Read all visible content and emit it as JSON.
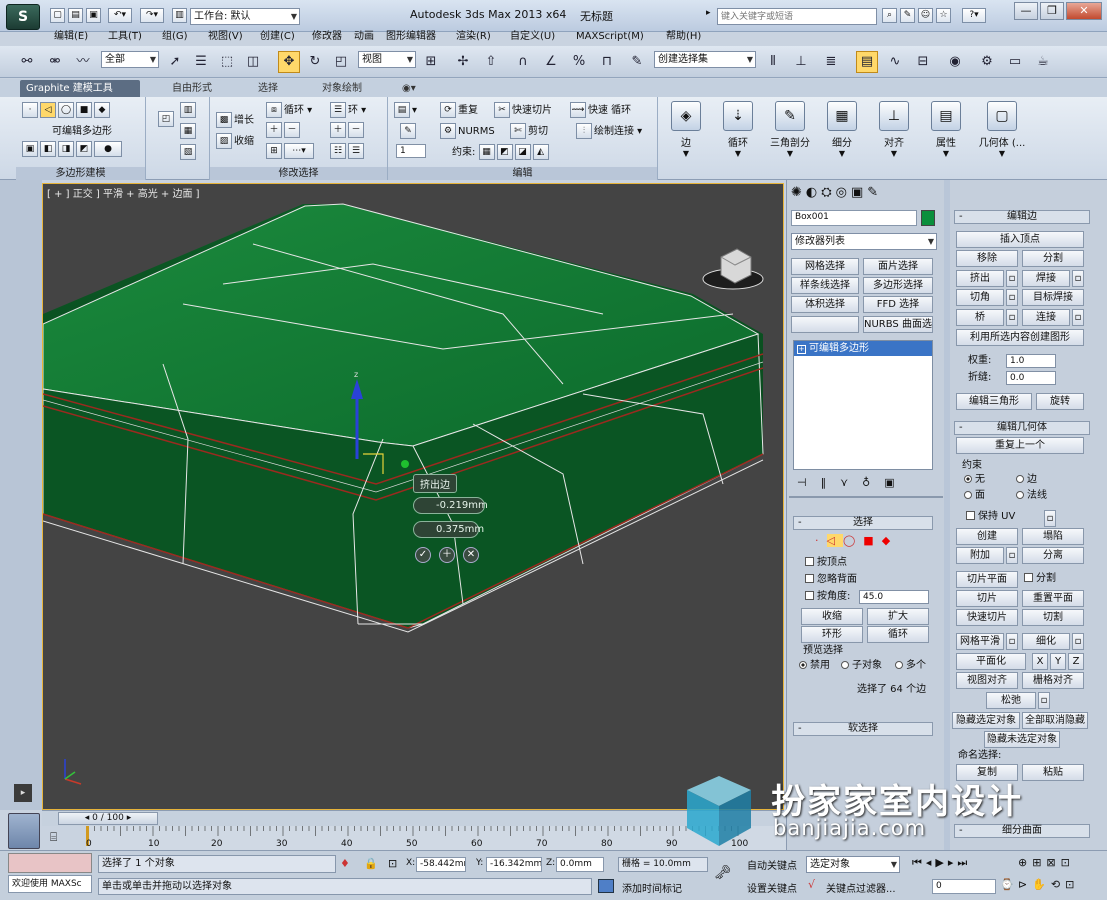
{
  "app": {
    "title": "Autodesk 3ds Max  2013 x64",
    "doc": "无标题",
    "workspace": "工作台: 默认",
    "search_placeholder": "键入关键字或短语",
    "logo": "S",
    "quick_icons": [
      "new-icon",
      "open-icon",
      "save-icon",
      "undo-icon",
      "redo-icon",
      "project-icon"
    ],
    "window_controls": [
      "—",
      "❐",
      "✕"
    ]
  },
  "menus": [
    "编辑(E)",
    "工具(T)",
    "组(G)",
    "视图(V)",
    "创建(C)",
    "修改器",
    "动画",
    "图形编辑器",
    "渲染(R)",
    "自定义(U)",
    "MAXScript(M)",
    "帮助(H)"
  ],
  "main_toolbar": {
    "selection_filter": "全部",
    "ref_coord": "视图",
    "named_selection": "创建选择集"
  },
  "ribbon": {
    "tabs": [
      "Graphite 建模工具",
      "自由形式",
      "选择",
      "对象绘制"
    ],
    "panel1": {
      "label": "多边形建模",
      "sub": "可编辑多边形"
    },
    "panel2": {
      "label": "修改选择",
      "grow": "增长",
      "shrink": "收缩",
      "loop": "循环",
      "ring": "环"
    },
    "panel3": {
      "label": "编辑",
      "repeat": "重复",
      "quickslice": "快速切片",
      "quickloop": "快速 循环",
      "nurms": "NURMS",
      "cut": "剪切",
      "paintconnect": "绘制连接",
      "constraint": "约束:",
      "spinner": "1"
    },
    "big": [
      "边",
      "循环",
      "三角剖分",
      "细分",
      "对齐",
      "属性",
      "几何体 (..."
    ]
  },
  "viewport": {
    "label": "[ + ] 正交 ] 平滑 + 高光 + 边面 ]",
    "caddy_title": "挤出边",
    "caddy_height": "-0.219mm",
    "caddy_width": "0.375mm",
    "colors": {
      "frame": "#e7b43a",
      "mesh": "#0f6b30",
      "bg": "#444444"
    }
  },
  "command_panel": {
    "object_name": "Box001",
    "object_color": "#0a8f3c",
    "modifier_list": "修改器列表",
    "mod_buttons": [
      "网格选择",
      "面片选择",
      "样条线选择",
      "多边形选择",
      "体积选择",
      "FFD 选择",
      "NURBS 曲面选择"
    ],
    "stack_item": "可编辑多边形",
    "selection_rollout": "选择",
    "by_vertex": "按顶点",
    "ignore_back": "忽略背面",
    "by_angle": "按角度:",
    "angle_value": "45.0",
    "shrink": "收缩",
    "grow": "扩大",
    "ring": "环形",
    "loop": "循环",
    "preview": "预览选择",
    "preview_opts": [
      "禁用",
      "子对象",
      "多个"
    ],
    "selected_info": "选择了 64 个边",
    "soft_selection": "软选择"
  },
  "edit_edges": {
    "title": "编辑边",
    "insert_vertex": "插入顶点",
    "remove": "移除",
    "split": "分割",
    "extrude": "挤出",
    "weld": "焊接",
    "chamfer": "切角",
    "target_weld": "目标焊接",
    "bridge": "桥",
    "connect": "连接",
    "create_shape": "利用所选内容创建图形",
    "weight_label": "权重:",
    "weight": "1.0",
    "crease_label": "折缝:",
    "crease": "0.0",
    "edit_tri": "编辑三角形",
    "turn": "旋转"
  },
  "edit_geometry": {
    "title": "编辑几何体",
    "repeat_last": "重复上一个",
    "constraints": "约束",
    "c_none": "无",
    "c_edge": "边",
    "c_face": "面",
    "c_normal": "法线",
    "keep_uv": "保持 UV",
    "create": "创建",
    "collapse": "塌陷",
    "attach": "附加",
    "detach": "分离",
    "slice_plane": "切片平面",
    "split": "分割",
    "slice": "切片",
    "reset_plane": "重置平面",
    "quickslice": "快速切片",
    "cut": "切割",
    "msmooth": "网格平滑",
    "tessellate": "细化",
    "make_planar": "平面化",
    "x": "X",
    "y": "Y",
    "z": "Z",
    "view_align": "视图对齐",
    "grid_align": "栅格对齐",
    "relax": "松弛",
    "hide_sel": "隐藏选定对象",
    "unhide_all": "全部取消隐藏",
    "hide_unsel": "隐藏未选定对象",
    "named_sel": "命名选择:",
    "copy": "复制",
    "paste": "粘贴",
    "subdiv": "细分曲面"
  },
  "timeline": {
    "frame": "0 / 100",
    "ticks": [
      "0",
      "10",
      "20",
      "30",
      "40",
      "50",
      "60",
      "70",
      "80",
      "90",
      "100"
    ]
  },
  "status": {
    "welcome": "欢迎使用 MAXSc",
    "selected": "选择了 1 个对象",
    "prompt": "单击或单击并拖动以选择对象",
    "x_label": "X:",
    "x": "-58.442mm",
    "y_label": "Y:",
    "y": "-16.342mm",
    "z_label": "Z:",
    "z": "0.0mm",
    "grid": "栅格 = 10.0mm",
    "add_time_tag": "添加时间标记",
    "auto_key": "自动关键点",
    "set_key": "设置关键点",
    "selected_obj": "选定对象",
    "key_filter": "关键点过滤器...",
    "frame_field": "0"
  },
  "watermark": {
    "brand": "扮家家室内设计",
    "url": "banjiajia.com"
  }
}
